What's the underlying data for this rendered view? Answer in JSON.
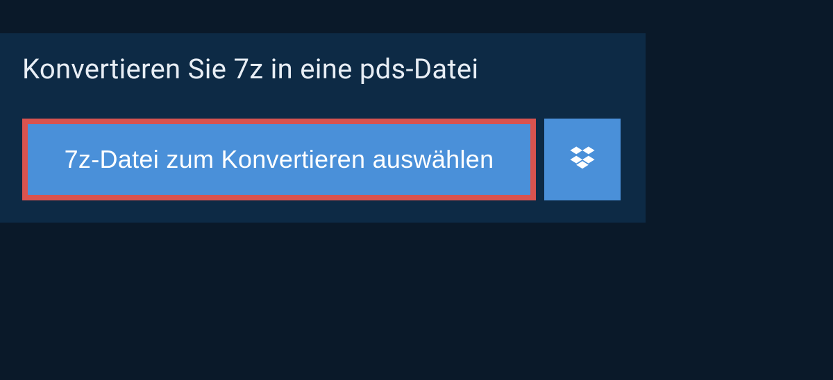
{
  "panel": {
    "title": "Konvertieren Sie 7z in eine pds-Datei",
    "select_button_label": "7z-Datei zum Konvertieren auswählen"
  },
  "colors": {
    "background": "#0a1929",
    "panel": "#0d2a45",
    "button": "#4a90d9",
    "highlight_border": "#d9534f",
    "text_light": "#e8eef5",
    "text_white": "#ffffff"
  },
  "icons": {
    "dropbox": "dropbox-icon"
  }
}
